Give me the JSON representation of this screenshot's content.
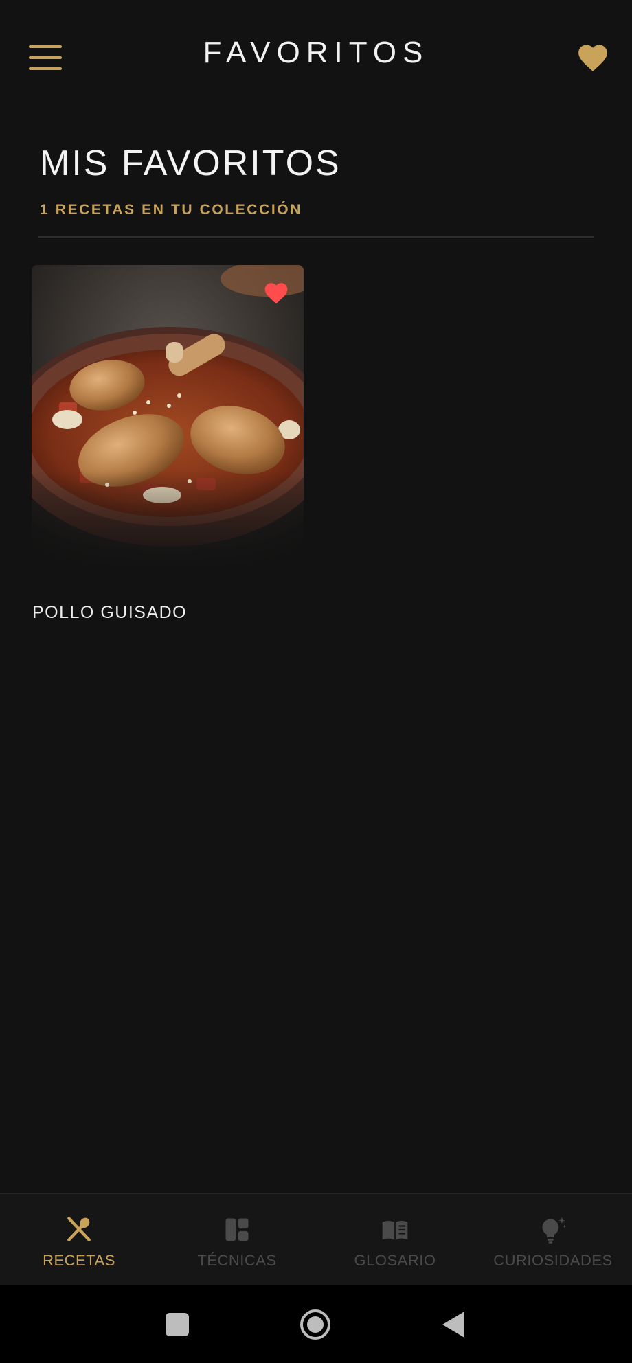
{
  "header": {
    "title": "FAVORITOS",
    "menu_icon": "hamburger-menu-icon",
    "favorites_icon": "heart-icon"
  },
  "main": {
    "heading": "MIS FAVORITOS",
    "subheading": "1 RECETAS EN TU COLECCIÓN",
    "recipes": [
      {
        "title": "POLLO GUISADO",
        "image": "stewed chicken drumsticks in a clay bowl",
        "favorite": true
      }
    ]
  },
  "bottom_nav": {
    "items": [
      {
        "label": "RECETAS",
        "icon": "fork-spoon-icon",
        "active": true
      },
      {
        "label": "TÉCNICAS",
        "icon": "layout-grid-icon",
        "active": false
      },
      {
        "label": "GLOSARIO",
        "icon": "book-icon",
        "active": false
      },
      {
        "label": "CURIOSIDADES",
        "icon": "lightbulb-icon",
        "active": false
      }
    ]
  },
  "system_nav": {
    "buttons": [
      "recents-square-icon",
      "home-circle-icon",
      "back-triangle-icon"
    ]
  },
  "colors": {
    "background": "#121212",
    "accent_gold": "#c9a35a",
    "heart_red": "#ff4d4d",
    "inactive": "#4a4a4a"
  }
}
